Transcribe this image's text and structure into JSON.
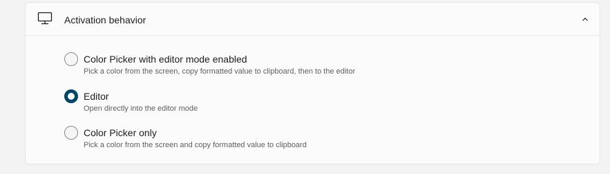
{
  "section": {
    "icon": "monitor-icon",
    "title": "Activation behavior",
    "collapse_icon": "chevron-up-icon",
    "expanded": true
  },
  "options": [
    {
      "label": "Color Picker with editor mode enabled",
      "description": "Pick a color from the screen, copy formatted value to clipboard, then to the editor",
      "selected": false
    },
    {
      "label": "Editor",
      "description": "Open directly into the editor mode",
      "selected": true
    },
    {
      "label": "Color Picker only",
      "description": "Pick a color from the screen and copy formatted value to clipboard",
      "selected": false
    }
  ],
  "colors": {
    "accent": "#00456c",
    "page_background": "#f3f3f3",
    "card_background": "#fbfbfb",
    "secondary_text": "#5f5f5f"
  }
}
